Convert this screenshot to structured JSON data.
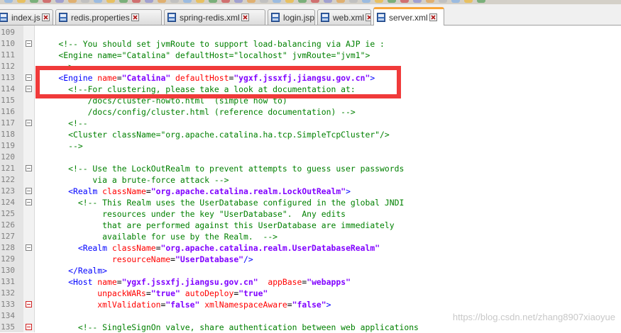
{
  "tabs": [
    {
      "label": "index.js",
      "active": false,
      "icon": "notepad-file-icon"
    },
    {
      "label": "redis.properties",
      "active": false,
      "icon": "notepad-file-icon"
    },
    {
      "label": "spring-redis.xml",
      "active": false,
      "icon": "notepad-file-icon"
    },
    {
      "label": "login.jsp",
      "active": false,
      "icon": "notepad-file-icon"
    },
    {
      "label": "web.xml",
      "active": false,
      "icon": "notepad-file-icon"
    },
    {
      "label": "server.xml",
      "active": true,
      "icon": "notepad-file-icon"
    }
  ],
  "colors": {
    "tag": "#0000ff",
    "attribute": "#ff0000",
    "string": "#8000ff",
    "comment": "#008000",
    "highlight_box": "#f03a3a",
    "active_tab_accent": "#f9a638"
  },
  "lines": [
    {
      "num": "109",
      "fold": "none",
      "tokens": []
    },
    {
      "num": "110",
      "fold": "minus",
      "tokens": [
        {
          "t": "com",
          "v": "    <!-- You should set jvmRoute to support load-balancing via AJP ie :"
        }
      ]
    },
    {
      "num": "111",
      "fold": "none",
      "tokens": [
        {
          "t": "com",
          "v": "    <Engine name=\"Catalina\" defaultHost=\"localhost\" jvmRoute=\"jvm1\">"
        }
      ]
    },
    {
      "num": "112",
      "fold": "none",
      "tokens": [
        {
          "t": "com",
          "v": "    -->"
        }
      ]
    },
    {
      "num": "113",
      "fold": "minus",
      "tokens": [
        {
          "t": "tag",
          "v": "    <Engine "
        },
        {
          "t": "att",
          "v": "name"
        },
        {
          "t": "pun",
          "v": "="
        },
        {
          "t": "str",
          "v": "\"Catalina\""
        },
        {
          "t": "pun",
          "v": " "
        },
        {
          "t": "att",
          "v": "defaultHost"
        },
        {
          "t": "pun",
          "v": "="
        },
        {
          "t": "str",
          "v": "\"ygxf.jssxfj.jiangsu.gov.cn\""
        },
        {
          "t": "tag",
          "v": ">"
        }
      ]
    },
    {
      "num": "114",
      "fold": "minus",
      "tokens": [
        {
          "t": "com",
          "v": "      <!--For clustering, please take a look at documentation at:"
        }
      ]
    },
    {
      "num": "115",
      "fold": "none",
      "tokens": [
        {
          "t": "com",
          "v": "          /docs/cluster-howto.html  (simple how to)"
        }
      ]
    },
    {
      "num": "116",
      "fold": "none",
      "tokens": [
        {
          "t": "com",
          "v": "          /docs/config/cluster.html (reference documentation) -->"
        }
      ]
    },
    {
      "num": "117",
      "fold": "minus",
      "tokens": [
        {
          "t": "com",
          "v": "      <!--"
        }
      ]
    },
    {
      "num": "118",
      "fold": "none",
      "tokens": [
        {
          "t": "com",
          "v": "      <Cluster className=\"org.apache.catalina.ha.tcp.SimpleTcpCluster\"/>"
        }
      ]
    },
    {
      "num": "119",
      "fold": "none",
      "tokens": [
        {
          "t": "com",
          "v": "      -->"
        }
      ]
    },
    {
      "num": "120",
      "fold": "none",
      "tokens": []
    },
    {
      "num": "121",
      "fold": "minus",
      "tokens": [
        {
          "t": "com",
          "v": "      <!-- Use the LockOutRealm to prevent attempts to guess user passwords"
        }
      ]
    },
    {
      "num": "122",
      "fold": "none",
      "tokens": [
        {
          "t": "com",
          "v": "           via a brute-force attack -->"
        }
      ]
    },
    {
      "num": "123",
      "fold": "minus",
      "tokens": [
        {
          "t": "tag",
          "v": "      <Realm "
        },
        {
          "t": "att",
          "v": "className"
        },
        {
          "t": "pun",
          "v": "="
        },
        {
          "t": "str",
          "v": "\"org.apache.catalina.realm.LockOutRealm\""
        },
        {
          "t": "tag",
          "v": ">"
        }
      ]
    },
    {
      "num": "124",
      "fold": "minus",
      "tokens": [
        {
          "t": "com",
          "v": "        <!-- This Realm uses the UserDatabase configured in the global JNDI"
        }
      ]
    },
    {
      "num": "125",
      "fold": "none",
      "tokens": [
        {
          "t": "com",
          "v": "             resources under the key \"UserDatabase\".  Any edits"
        }
      ]
    },
    {
      "num": "126",
      "fold": "none",
      "tokens": [
        {
          "t": "com",
          "v": "             that are performed against this UserDatabase are immediately"
        }
      ]
    },
    {
      "num": "127",
      "fold": "none",
      "tokens": [
        {
          "t": "com",
          "v": "             available for use by the Realm.  -->"
        }
      ]
    },
    {
      "num": "128",
      "fold": "minus",
      "tokens": [
        {
          "t": "tag",
          "v": "        <Realm "
        },
        {
          "t": "att",
          "v": "className"
        },
        {
          "t": "pun",
          "v": "="
        },
        {
          "t": "str",
          "v": "\"org.apache.catalina.realm.UserDatabaseRealm\""
        }
      ]
    },
    {
      "num": "129",
      "fold": "none",
      "tokens": [
        {
          "t": "att",
          "v": "               resourceName"
        },
        {
          "t": "pun",
          "v": "="
        },
        {
          "t": "str",
          "v": "\"UserDatabase\""
        },
        {
          "t": "tag",
          "v": "/>"
        }
      ]
    },
    {
      "num": "130",
      "fold": "none",
      "tokens": [
        {
          "t": "tag",
          "v": "      </Realm>"
        }
      ]
    },
    {
      "num": "131",
      "fold": "none",
      "tokens": [
        {
          "t": "tag",
          "v": "      <Host "
        },
        {
          "t": "att",
          "v": "name"
        },
        {
          "t": "pun",
          "v": "="
        },
        {
          "t": "str",
          "v": "\"ygxf.jssxfj.jiangsu.gov.cn\""
        },
        {
          "t": "pun",
          "v": "  "
        },
        {
          "t": "att",
          "v": "appBase"
        },
        {
          "t": "pun",
          "v": "="
        },
        {
          "t": "str",
          "v": "\"webapps\""
        }
      ]
    },
    {
      "num": "132",
      "fold": "none",
      "tokens": [
        {
          "t": "att",
          "v": "            unpackWARs"
        },
        {
          "t": "pun",
          "v": "="
        },
        {
          "t": "str",
          "v": "\"true\""
        },
        {
          "t": "pun",
          "v": " "
        },
        {
          "t": "att",
          "v": "autoDeploy"
        },
        {
          "t": "pun",
          "v": "="
        },
        {
          "t": "str",
          "v": "\"true\""
        }
      ]
    },
    {
      "num": "133",
      "fold": "minus-red",
      "tokens": [
        {
          "t": "att",
          "v": "            xmlValidation"
        },
        {
          "t": "pun",
          "v": "="
        },
        {
          "t": "str",
          "v": "\"false\""
        },
        {
          "t": "pun",
          "v": " "
        },
        {
          "t": "att",
          "v": "xmlNamespaceAware"
        },
        {
          "t": "pun",
          "v": "="
        },
        {
          "t": "str",
          "v": "\"false\""
        },
        {
          "t": "tag",
          "v": ">"
        }
      ]
    },
    {
      "num": "134",
      "fold": "none",
      "tokens": []
    },
    {
      "num": "135",
      "fold": "minus-red",
      "tokens": [
        {
          "t": "com",
          "v": "        <!-- SingleSignOn valve, share authentication between web applications"
        }
      ]
    }
  ],
  "watermark": "https://blog.csdn.net/zhang8907xiaoyue"
}
